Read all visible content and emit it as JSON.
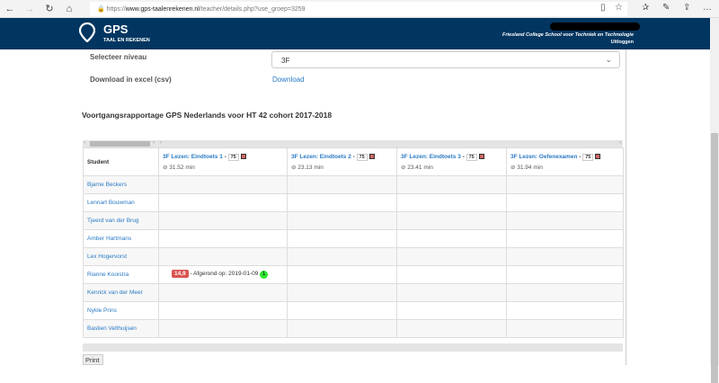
{
  "browser": {
    "url_prefix": "https://",
    "url_domain": "www.gps-taalenrekenen.nl",
    "url_path": "/teacher/details.php?use_groep=3259"
  },
  "header": {
    "brand": "GPS",
    "subtitle": "TAAL EN REKENEN",
    "school": "Friesland College School voor Techniek en Technologie",
    "logout": "Uitloggen"
  },
  "form": {
    "level_label": "Selecteer niveau",
    "level_value": "3F",
    "download_label": "Download in excel (csv)",
    "download_link": "Download"
  },
  "report_title": "Voortgangsrapportage GPS Nederlands voor HT 42 cohort 2017-2018",
  "table": {
    "student_header": "Student",
    "tests": [
      {
        "name": "3F Lezen: Eindtoets 1",
        "score": "75",
        "time": "31.52 min"
      },
      {
        "name": "3F Lezen: Eindtoets 2",
        "score": "75",
        "time": "23.13 min"
      },
      {
        "name": "3F Lezen: Eindtoets 3",
        "score": "75",
        "time": "23.41 min"
      },
      {
        "name": "3F Lezen: Oefenexamen",
        "score": "75",
        "time": "31.94 min"
      }
    ],
    "students": [
      "Bjarne Beckers",
      "Lennart Bouwman",
      "Tjeerd van der Brug",
      "Amber Hartmans",
      "Lex Hogervorst",
      "Rianne Kooistra",
      "Kenrick van der Meer",
      "Nykle Prins",
      "Bastien Velthuijsen"
    ],
    "result": {
      "score": "14,9",
      "text": "- Afgerond op: 2019-01-09",
      "count": "1"
    }
  },
  "print_label": "Print",
  "colors": {
    "header": "#023660",
    "link": "#2a7ac4",
    "score": "#d9534f",
    "count": "#2ee62e"
  }
}
